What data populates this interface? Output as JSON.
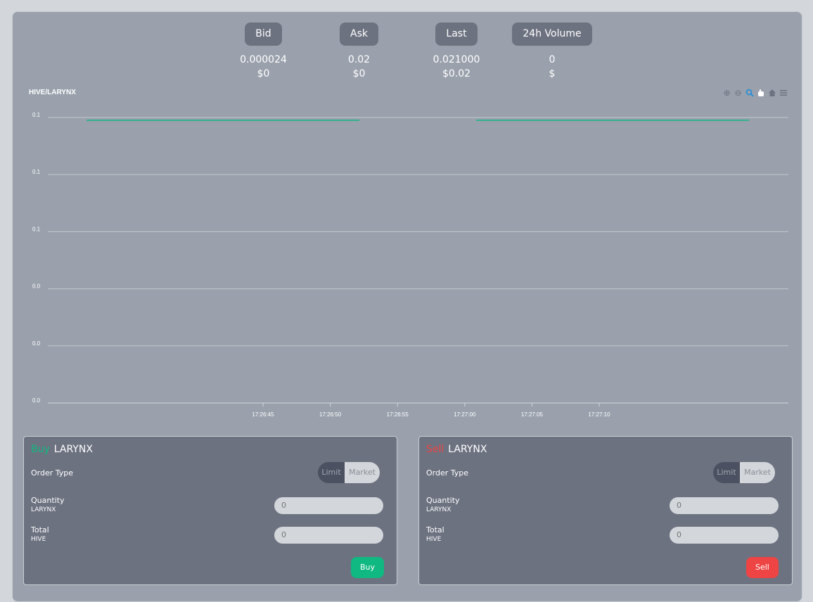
{
  "stats": [
    {
      "label": "Bid",
      "value": "0.000024",
      "usd": "$0"
    },
    {
      "label": "Ask",
      "value": "0.02",
      "usd": "$0"
    },
    {
      "label": "Last",
      "value": "0.021000",
      "usd": "$0.02"
    },
    {
      "label": "24h Volume",
      "value": "0",
      "usd": "$"
    }
  ],
  "chart": {
    "title": "HIVE/LARYNX",
    "toolbar_icons": [
      "zoom-in-icon",
      "zoom-out-icon",
      "magnify-icon",
      "pan-hand-icon",
      "home-icon",
      "menu-icon"
    ],
    "accent": "#2b8fd6"
  },
  "chart_data": {
    "type": "line",
    "title": "HIVE/LARYNX",
    "y_tick_labels": [
      "0.1",
      "0.1",
      "0.1",
      "0.0",
      "0.0",
      "0.0"
    ],
    "x_tick_labels": [
      "17:26:45",
      "17:26:50",
      "17:26:55",
      "17:27:00",
      "17:27:05",
      "17:27:10"
    ],
    "series": [
      {
        "color": "#10b981",
        "segments": [
          [
            0.1,
            0.1
          ],
          [
            0.1,
            0.1
          ]
        ]
      }
    ],
    "grid": true
  },
  "buy": {
    "action": "Buy",
    "symbol": "LARYNX",
    "order_type_label": "Order Type",
    "limit_label": "Limit",
    "market_label": "Market",
    "quantity_label": "Quantity",
    "quantity_unit": "LARYNX",
    "quantity_placeholder": "0",
    "total_label": "Total",
    "total_unit": "HIVE",
    "total_placeholder": "0",
    "button_label": "Buy",
    "color": "#10b981"
  },
  "sell": {
    "action": "Sell",
    "symbol": "LARYNX",
    "order_type_label": "Order Type",
    "limit_label": "Limit",
    "market_label": "Market",
    "quantity_label": "Quantity",
    "quantity_unit": "LARYNX",
    "quantity_placeholder": "0",
    "total_label": "Total",
    "total_unit": "HIVE",
    "total_placeholder": "0",
    "button_label": "Sell",
    "color": "#ef4444"
  }
}
